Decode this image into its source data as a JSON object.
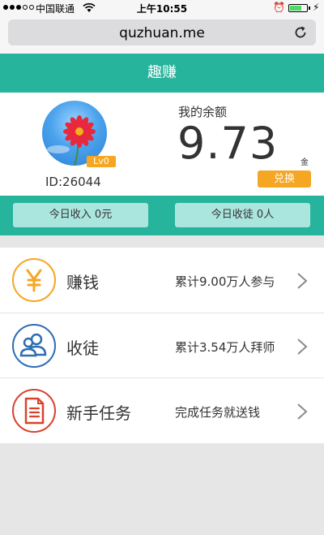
{
  "status_bar": {
    "carrier": "中国联通",
    "time": "上午10:55",
    "battery_level": 0.7
  },
  "browser": {
    "url": "quzhuan.me"
  },
  "app": {
    "title": "趣赚"
  },
  "profile": {
    "level": "Lv0",
    "user_id": "ID:26044",
    "balance_label": "我的余额",
    "balance": "9.73",
    "balance_unit": "金",
    "exchange_label": "兑换"
  },
  "stats": {
    "today_income": "今日收入  0元",
    "today_apprentice": "今日收徒  0人"
  },
  "menu": {
    "items": [
      {
        "label": "赚钱",
        "desc": "累计9.00万人参与",
        "icon": "yen-icon",
        "color": "#f5a623"
      },
      {
        "label": "收徒",
        "desc": "累计3.54万人拜师",
        "icon": "users-icon",
        "color": "#2c6db3"
      },
      {
        "label": "新手任务",
        "desc": "完成任务就送钱",
        "icon": "document-icon",
        "color": "#d9432e"
      }
    ]
  },
  "colors": {
    "primary": "#26b49c",
    "accent": "#f5a623",
    "pill": "#abe6de"
  }
}
